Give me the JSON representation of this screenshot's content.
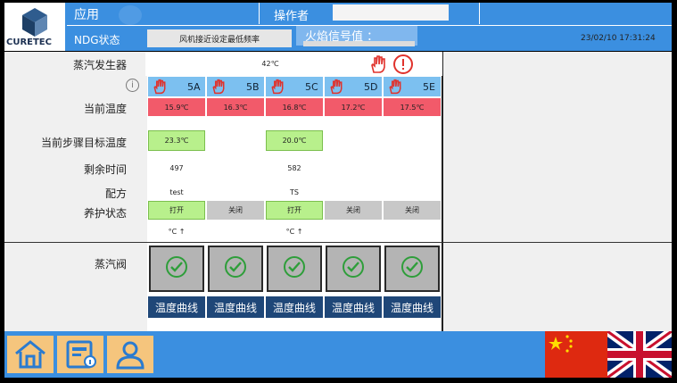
{
  "header": {
    "app_label": "应用",
    "operator_label": "操作者",
    "operator_value": "",
    "ndg_label": "NDG状态",
    "ndg_status": "风机接近设定最低频率",
    "flame_label": "火焰信号值 ：",
    "datetime": "23/02/10 17:31:24",
    "logo_text": "CURETEC"
  },
  "labels": {
    "steam_generator": "蒸汽发生器",
    "current_temp": "当前温度",
    "step_target_temp": "当前步骤目标温度",
    "remaining_time": "剩余时间",
    "recipe": "配方",
    "curing_status": "养护状态",
    "steam_valve": "蒸汽阀"
  },
  "steam_generator_temp": "42℃",
  "columns": [
    {
      "name": "5A",
      "current_temp": "15.9℃",
      "target_temp": "23.3℃",
      "remaining": "497",
      "recipe": "test",
      "status": "打开",
      "status_on": true,
      "unit": "°C ↑",
      "curve": "温度曲线"
    },
    {
      "name": "5B",
      "current_temp": "16.3℃",
      "target_temp": "",
      "remaining": "",
      "recipe": "",
      "status": "关闭",
      "status_on": false,
      "unit": "",
      "curve": "温度曲线"
    },
    {
      "name": "5C",
      "current_temp": "16.8℃",
      "target_temp": "20.0℃",
      "remaining": "582",
      "recipe": "TS",
      "status": "打开",
      "status_on": true,
      "unit": "°C ↑",
      "curve": "温度曲线"
    },
    {
      "name": "5D",
      "current_temp": "17.2℃",
      "target_temp": "",
      "remaining": "",
      "recipe": "",
      "status": "关闭",
      "status_on": false,
      "unit": "",
      "curve": "温度曲线"
    },
    {
      "name": "5E",
      "current_temp": "17.5℃",
      "target_temp": "",
      "remaining": "",
      "recipe": "",
      "status": "关闭",
      "status_on": false,
      "unit": "",
      "curve": "温度曲线"
    }
  ],
  "colors": {
    "header_blue": "#3b8fe0",
    "current_temp_red": "#f25a6a",
    "status_green": "#b8f08c",
    "curve_button": "#1f4778",
    "alarm_red": "#e0322c",
    "check_green": "#2e9e3a"
  },
  "icons": [
    "hand-stop-icon",
    "alarm-icon",
    "info-icon",
    "check-circle-icon",
    "home-icon",
    "report-icon",
    "user-icon",
    "china-flag-icon",
    "uk-flag-icon"
  ]
}
